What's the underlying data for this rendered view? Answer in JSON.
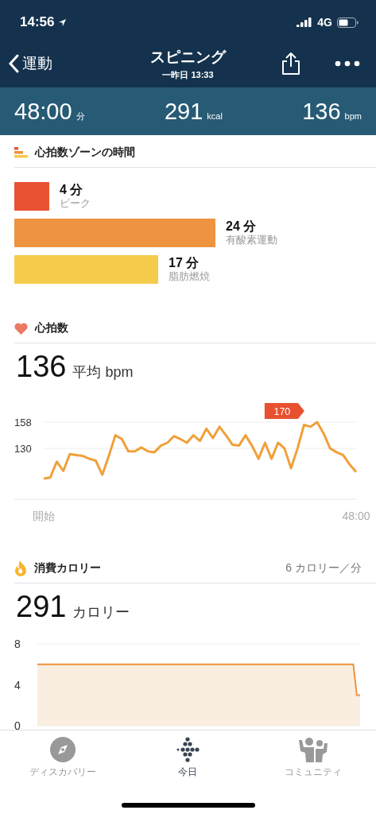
{
  "status_bar": {
    "time": "14:56",
    "network": "4G"
  },
  "nav": {
    "back": "運動",
    "title": "スピニング",
    "subtitle": "一昨日 13:33"
  },
  "summary": [
    {
      "value": "48:00",
      "unit": "分"
    },
    {
      "value": "291",
      "unit": "kcal"
    },
    {
      "value": "136",
      "unit": "bpm"
    }
  ],
  "zones": {
    "title": "心拍数ゾーンの時間",
    "items": [
      {
        "time": "4 分",
        "label": "ピーク",
        "kind": "peak",
        "color": "#ea5234"
      },
      {
        "time": "24 分",
        "label": "有酸素運動",
        "kind": "cardio",
        "color": "#ee9340"
      },
      {
        "time": "17 分",
        "label": "脂肪燃焼",
        "kind": "fatburn",
        "color": "#f5cb4c"
      }
    ]
  },
  "heart_rate": {
    "title": "心拍数",
    "value": "136",
    "unit": "平均 bpm",
    "chart_data": {
      "type": "line",
      "categories": [
        "開始",
        null,
        null,
        null,
        null,
        null,
        null,
        null,
        null,
        null,
        null,
        null,
        null,
        null,
        null,
        null,
        null,
        null,
        null,
        null,
        null,
        null,
        null,
        null,
        null,
        null,
        null,
        null,
        null,
        null,
        null,
        null,
        null,
        null,
        null,
        null,
        null,
        null,
        null,
        null,
        null,
        null,
        null,
        null,
        null,
        null,
        null,
        null,
        "48:00"
      ],
      "series": [
        {
          "color": "#f0a03a",
          "values": [
            98,
            99,
            116,
            106,
            124,
            123,
            122,
            119,
            117,
            102,
            122,
            144,
            140,
            127,
            127,
            131,
            127,
            126,
            133,
            136,
            143,
            140,
            136,
            144,
            138,
            151,
            141,
            153,
            144,
            134,
            133,
            144,
            133,
            119,
            136,
            119,
            136,
            130,
            109,
            130,
            155,
            153,
            158,
            146,
            130,
            126,
            123,
            113,
            105
          ]
        }
      ],
      "ylim": [
        76,
        158
      ],
      "yticks": [
        130,
        158
      ],
      "annotations": [
        "170"
      ]
    }
  },
  "calories": {
    "title": "消費カロリー",
    "rate": "6 カロリー／分",
    "value": "291",
    "unit": "カロリー",
    "chart_data": {
      "type": "area",
      "categories": [
        null,
        null,
        null,
        null,
        null,
        null,
        null,
        null,
        null,
        null,
        null,
        null,
        null,
        null,
        null,
        null,
        null,
        null,
        null,
        null,
        null,
        null,
        null,
        null,
        null,
        null,
        null,
        null,
        null,
        null,
        null,
        null,
        null,
        null,
        null,
        null,
        null,
        null,
        null,
        null,
        null,
        null,
        null,
        null,
        null,
        null,
        null,
        null,
        null,
        null,
        null,
        null,
        null,
        null,
        null,
        null,
        null,
        null,
        null,
        null,
        null,
        null,
        null,
        null,
        null,
        null,
        null,
        null,
        null,
        null,
        null,
        null,
        null,
        null,
        null,
        null,
        null,
        null,
        null,
        null,
        null,
        null,
        null,
        null,
        null,
        null,
        null,
        null,
        null,
        null,
        null,
        null,
        null,
        null,
        null,
        null,
        null
      ],
      "series": [
        {
          "color": "#ef9440",
          "values": [
            6,
            6,
            6,
            6,
            6,
            6,
            6,
            6,
            6,
            6,
            6,
            6,
            6,
            6,
            6,
            6,
            6,
            6,
            6,
            6,
            6,
            6,
            6,
            6,
            6,
            6,
            6,
            6,
            6,
            6,
            6,
            6,
            6,
            6,
            6,
            6,
            6,
            6,
            6,
            6,
            6,
            6,
            6,
            6,
            6,
            6,
            6,
            6,
            6,
            6,
            6,
            6,
            6,
            6,
            6,
            6,
            6,
            6,
            6,
            6,
            6,
            6,
            6,
            6,
            6,
            6,
            6,
            6,
            6,
            6,
            6,
            6,
            6,
            6,
            6,
            6,
            6,
            6,
            6,
            6,
            6,
            6,
            6,
            6,
            6,
            6,
            6,
            6,
            6,
            6,
            6,
            6,
            6,
            6,
            6,
            3,
            3
          ]
        }
      ],
      "ylim": [
        0,
        8
      ],
      "yticks": [
        0,
        4,
        8
      ]
    }
  },
  "tab_bar": [
    {
      "label": "ディスカバリー",
      "kind": "compass",
      "selected": false
    },
    {
      "label": "今日",
      "kind": "dots",
      "selected": true
    },
    {
      "label": "コミュニティ",
      "kind": "people",
      "selected": false
    }
  ]
}
